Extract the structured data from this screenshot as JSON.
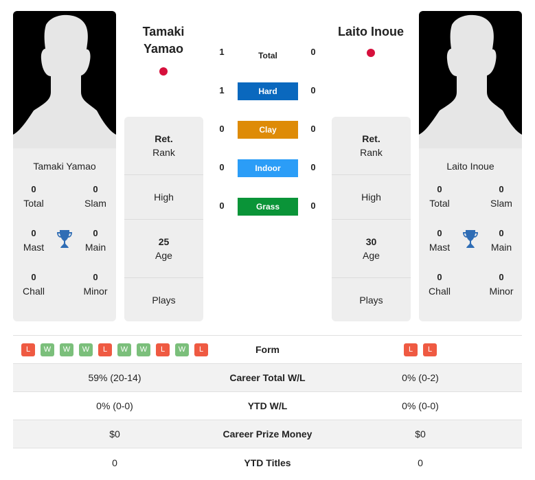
{
  "player1": {
    "name": "Tamaki Yamao",
    "name_line1": "Tamaki",
    "name_line2": "Yamao",
    "flag_color": "#d6103c",
    "titles": {
      "total": "0",
      "total_label": "Total",
      "slam": "0",
      "slam_label": "Slam",
      "mast": "0",
      "mast_label": "Mast",
      "main": "0",
      "main_label": "Main",
      "chall": "0",
      "chall_label": "Chall",
      "minor": "0",
      "minor_label": "Minor"
    },
    "info": {
      "rank_value": "Ret.",
      "rank_label": "Rank",
      "high_label": "High",
      "age_value": "25",
      "age_label": "Age",
      "plays_label": "Plays"
    },
    "form": [
      "L",
      "W",
      "W",
      "W",
      "L",
      "W",
      "W",
      "L",
      "W",
      "L"
    ]
  },
  "player2": {
    "name": "Laito Inoue",
    "flag_color": "#d6103c",
    "titles": {
      "total": "0",
      "total_label": "Total",
      "slam": "0",
      "slam_label": "Slam",
      "mast": "0",
      "mast_label": "Mast",
      "main": "0",
      "main_label": "Main",
      "chall": "0",
      "chall_label": "Chall",
      "minor": "0",
      "minor_label": "Minor"
    },
    "info": {
      "rank_value": "Ret.",
      "rank_label": "Rank",
      "high_label": "High",
      "age_value": "30",
      "age_label": "Age",
      "plays_label": "Plays"
    },
    "form": [
      "L",
      "L"
    ]
  },
  "h2h": [
    {
      "label": "Total",
      "left": "1",
      "right": "0",
      "color": null
    },
    {
      "label": "Hard",
      "left": "1",
      "right": "0",
      "color": "#0a68be"
    },
    {
      "label": "Clay",
      "left": "0",
      "right": "0",
      "color": "#de8b07"
    },
    {
      "label": "Indoor",
      "left": "0",
      "right": "0",
      "color": "#2b9df7"
    },
    {
      "label": "Grass",
      "left": "0",
      "right": "0",
      "color": "#0a9438"
    }
  ],
  "stats": {
    "form_label": "Form",
    "rows": [
      {
        "label": "Career Total W/L",
        "left": "59% (20-14)",
        "right": "0% (0-2)"
      },
      {
        "label": "YTD W/L",
        "left": "0% (0-0)",
        "right": "0% (0-0)"
      },
      {
        "label": "Career Prize Money",
        "left": "$0",
        "right": "$0"
      },
      {
        "label": "YTD Titles",
        "left": "0",
        "right": "0"
      }
    ]
  },
  "colors": {
    "win": "#7bbf7b",
    "loss": "#ef5a42",
    "trophy": "#2f6db5"
  }
}
